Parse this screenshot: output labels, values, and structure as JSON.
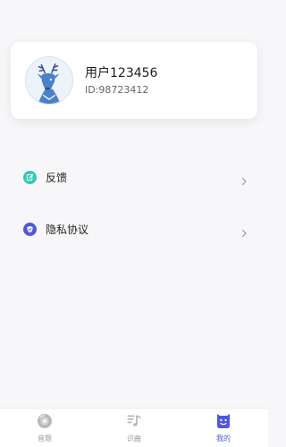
{
  "profile": {
    "username": "用户123456",
    "user_id": "ID:98723412",
    "avatar_icon": "deer-avatar-icon"
  },
  "menu": [
    {
      "label": "反馈",
      "icon": "edit-icon",
      "color": "#33c9b4"
    },
    {
      "label": "隐私协议",
      "icon": "shield-icon",
      "color": "#4f59d8"
    }
  ],
  "nav": {
    "items": [
      {
        "label": "音题",
        "icon": "disc-icon",
        "active": false
      },
      {
        "label": "识曲",
        "icon": "music-note-icon",
        "active": false
      },
      {
        "label": "我的",
        "icon": "smile-face-icon",
        "active": true
      }
    ],
    "active_color": "#4f59d8",
    "inactive_color": "#999999"
  }
}
